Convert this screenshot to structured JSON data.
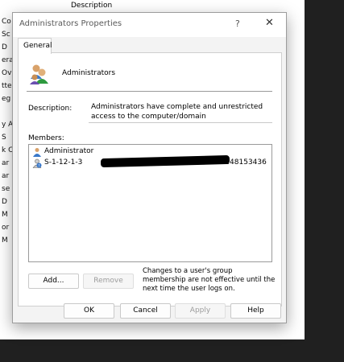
{
  "background": {
    "header": "Description",
    "left_column_fragments": [
      "Co",
      "Sc",
      "D",
      "era",
      "Ov",
      "tte",
      "eg",
      "",
      "y A",
      "S",
      "k C",
      "ar",
      "ar",
      "se",
      "D",
      "M",
      "or",
      "M"
    ]
  },
  "dialog": {
    "title": "Administrators Properties",
    "help_glyph": "?",
    "close_glyph": "✕",
    "tab": "General",
    "group_name": "Administrators",
    "description_label": "Description:",
    "description_value": "Administrators have complete and unrestricted access to the computer/domain",
    "members_label": "Members:",
    "members": [
      {
        "name": "Administrator",
        "icon": "user-icon"
      },
      {
        "name": "S-1-12-1-3",
        "suffix": "-2248153436",
        "icon": "unknown-user-icon",
        "redacted": true
      }
    ],
    "add_button": "Add...",
    "remove_button": "Remove",
    "note": "Changes to a user's group membership are not effective until the next time the user logs on.",
    "ok_button": "OK",
    "cancel_button": "Cancel",
    "apply_button": "Apply",
    "help_button": "Help"
  }
}
